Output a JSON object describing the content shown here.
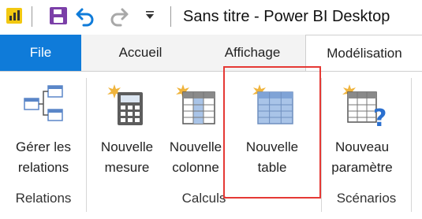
{
  "titlebar": {
    "title": "Sans titre - Power BI Desktop",
    "icons": [
      "power-bi-logo",
      "save-icon",
      "undo-icon",
      "redo-icon",
      "customize-quick-access-icon"
    ]
  },
  "tabs": {
    "file": "File",
    "accueil": "Accueil",
    "affichage": "Affichage",
    "modelisation": "Modélisation",
    "active": "Modélisation"
  },
  "ribbon": {
    "gerer_relations": {
      "line1": "Gérer les",
      "line2": "relations"
    },
    "nouvelle_mesure": {
      "line1": "Nouvelle",
      "line2": "mesure"
    },
    "nouvelle_colonne": {
      "line1": "Nouvelle",
      "line2": "colonne"
    },
    "nouvelle_table": {
      "line1": "Nouvelle",
      "line2": "table"
    },
    "nouveau_parametre": {
      "line1": "Nouveau",
      "line2": "paramètre"
    }
  },
  "groups": {
    "relations": "Relations",
    "calculs": "Calculs",
    "scenarios": "Scénarios"
  },
  "colors": {
    "file_tab": "#0f7bd9",
    "highlight": "#e53935",
    "save_icon": "#7b3fa8",
    "undo_icon": "#0f7bd9",
    "powerbi_yellow": "#f2c811"
  }
}
